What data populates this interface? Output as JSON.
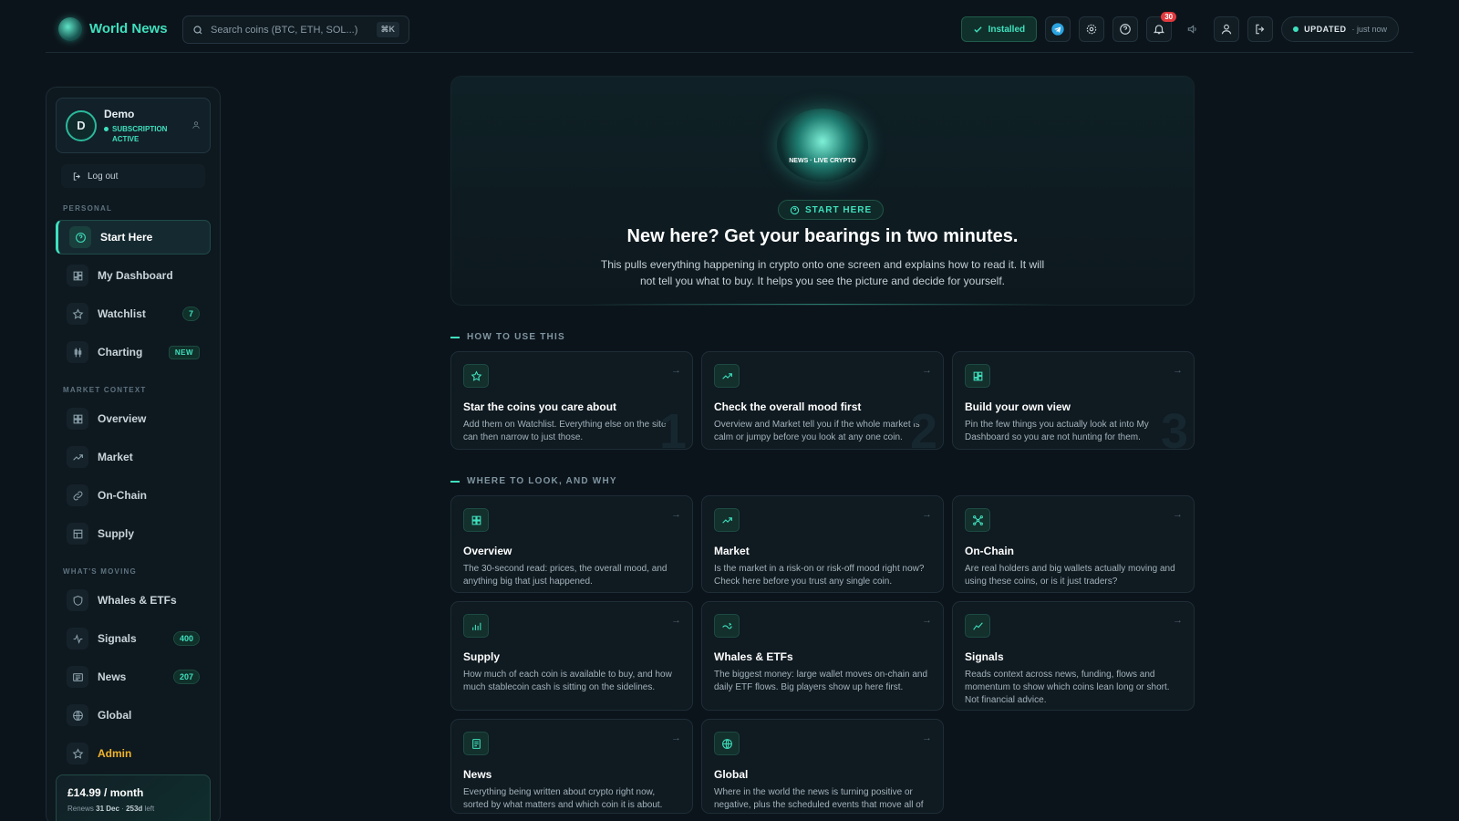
{
  "brand": {
    "name": "World News"
  },
  "search": {
    "placeholder": "Search coins (BTC, ETH, SOL...)",
    "shortcut": "⌘K"
  },
  "topbar": {
    "installed_label": "Installed",
    "notifications_count": "30",
    "updated_label": "UPDATED",
    "updated_time": "· just now"
  },
  "user": {
    "initial": "D",
    "name": "Demo",
    "status": "SUBSCRIPTION ACTIVE"
  },
  "sidebar": {
    "logout_label": "Log out",
    "sections": {
      "personal": "PERSONAL",
      "market": "MARKET CONTEXT",
      "moving": "WHAT'S MOVING"
    },
    "personal": [
      {
        "label": "Start Here",
        "icon": "help-circle-icon"
      },
      {
        "label": "My Dashboard",
        "icon": "dashboard-icon"
      },
      {
        "label": "Watchlist",
        "icon": "star-icon",
        "badge": "7"
      },
      {
        "label": "Charting",
        "icon": "candlestick-icon",
        "badge": "NEW"
      }
    ],
    "market": [
      {
        "label": "Overview",
        "icon": "grid-icon"
      },
      {
        "label": "Market",
        "icon": "trend-up-icon"
      },
      {
        "label": "On-Chain",
        "icon": "link-icon"
      },
      {
        "label": "Supply",
        "icon": "table-icon"
      }
    ],
    "moving": [
      {
        "label": "Whales & ETFs",
        "icon": "shield-icon"
      },
      {
        "label": "Signals",
        "icon": "activity-icon",
        "badge": "400"
      },
      {
        "label": "News",
        "icon": "newspaper-icon",
        "badge": "207"
      },
      {
        "label": "Global",
        "icon": "globe-icon"
      },
      {
        "label": "Admin",
        "icon": "star-icon"
      }
    ],
    "plan": {
      "price": "£14.99 / month",
      "renews_prefix": "Renews",
      "renews_date": "31 Dec",
      "renews_sep": "·",
      "renews_left": "253d",
      "renews_suffix": "left"
    }
  },
  "hero": {
    "logo_text": "NEWS · LIVE CRYPTO",
    "pill": "START HERE",
    "title": "New here? Get your bearings in two minutes.",
    "body": "This pulls everything happening in crypto onto one screen and explains how to read it. It will not tell you what to buy. It helps you see the picture and decide for yourself."
  },
  "how_to": {
    "heading": "HOW TO USE THIS",
    "cards": [
      {
        "title": "Star the coins you care about",
        "desc": "Add them on Watchlist. Everything else on the site can then narrow to just those.",
        "num": "1"
      },
      {
        "title": "Check the overall mood first",
        "desc": "Overview and Market tell you if the whole market is calm or jumpy before you look at any one coin.",
        "num": "2"
      },
      {
        "title": "Build your own view",
        "desc": "Pin the few things you actually look at into My Dashboard so you are not hunting for them.",
        "num": "3"
      }
    ]
  },
  "where": {
    "heading": "WHERE TO LOOK, AND WHY",
    "cards": [
      {
        "title": "Overview",
        "desc": "The 30-second read: prices, the overall mood, and anything big that just happened."
      },
      {
        "title": "Market",
        "desc": "Is the market in a risk-on or risk-off mood right now? Check here before you trust any single coin."
      },
      {
        "title": "On-Chain",
        "desc": "Are real holders and big wallets actually moving and using these coins, or is it just traders?"
      },
      {
        "title": "Supply",
        "desc": "How much of each coin is available to buy, and how much stablecoin cash is sitting on the sidelines."
      },
      {
        "title": "Whales & ETFs",
        "desc": "The biggest money: large wallet moves on-chain and daily ETF flows. Big players show up here first."
      },
      {
        "title": "Signals",
        "desc": "Reads context across news, funding, flows and momentum to show which coins lean long or short. Not financial advice."
      },
      {
        "title": "News",
        "desc": "Everything being written about crypto right now, sorted by what matters and which coin it is about."
      },
      {
        "title": "Global",
        "desc": "Where in the world the news is turning positive or negative, plus the scheduled events that move all of crypto."
      }
    ]
  },
  "colors": {
    "accent": "#3fe0be",
    "background": "#0c141b",
    "admin": "#f0b429",
    "badge_red": "#e0393e"
  }
}
